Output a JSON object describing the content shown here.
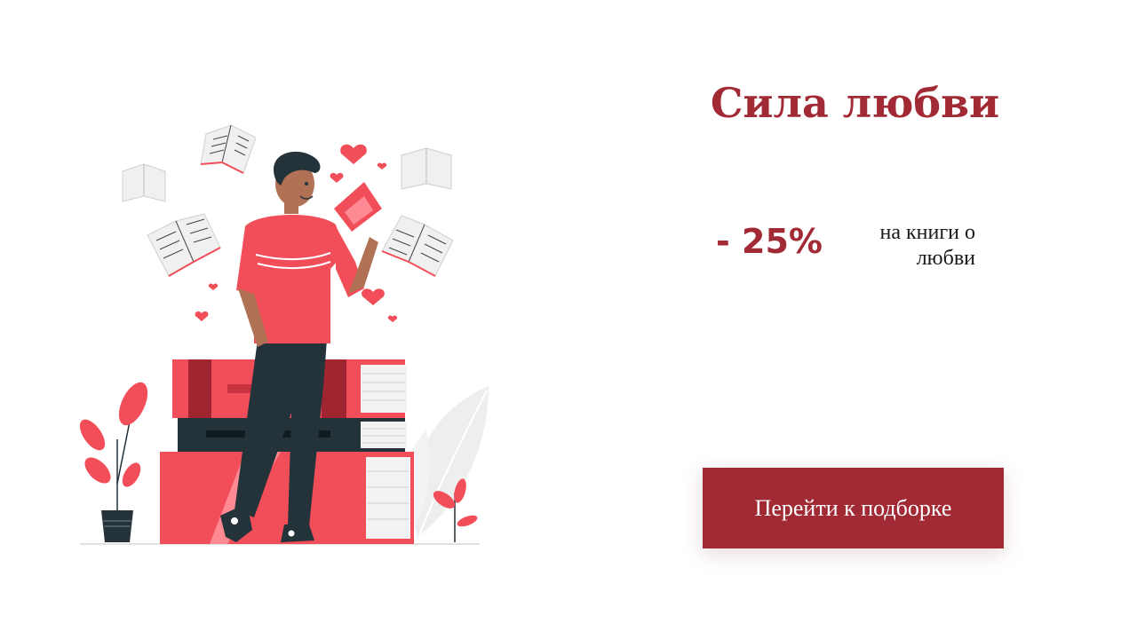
{
  "promo": {
    "title": "Сила любви",
    "discount": "- 25%",
    "subtitle": "на книги о любви",
    "cta_label": "Перейти к подборке"
  },
  "illustration": {
    "description_icon": "man-reading-book-illustration-icon"
  },
  "colors": {
    "accent": "#a22a35",
    "illustration_red": "#f24e5a",
    "illustration_dark": "#24333a",
    "text": "#1a1a1a",
    "background": "#ffffff"
  }
}
